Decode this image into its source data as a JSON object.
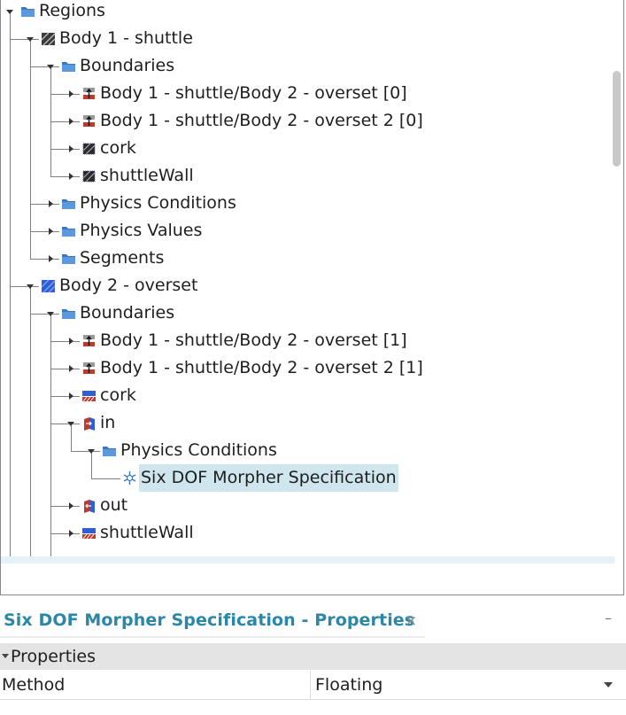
{
  "tree": {
    "nodes": [
      {
        "label": "Regions",
        "icon": "folder-icon",
        "depth": 0,
        "toggle": "expanded"
      },
      {
        "label": "Body 1 - shuttle",
        "icon": "region-hatched-icon",
        "depth": 1,
        "toggle": "expanded"
      },
      {
        "label": "Boundaries",
        "icon": "folder-icon",
        "depth": 2,
        "toggle": "expanded"
      },
      {
        "label": "Body 1 - shuttle/Body 2 - overset [0]",
        "icon": "interface-boundary-icon",
        "depth": 3,
        "toggle": "collapsed"
      },
      {
        "label": "Body 1 - shuttle/Body 2 - overset 2 [0]",
        "icon": "interface-boundary-icon",
        "depth": 3,
        "toggle": "collapsed"
      },
      {
        "label": "cork",
        "icon": "wall-boundary-icon",
        "depth": 3,
        "toggle": "collapsed"
      },
      {
        "label": "shuttleWall",
        "icon": "wall-boundary-icon",
        "depth": 3,
        "toggle": "collapsed"
      },
      {
        "label": "Physics Conditions",
        "icon": "folder-icon",
        "depth": 2,
        "toggle": "collapsed"
      },
      {
        "label": "Physics Values",
        "icon": "folder-icon",
        "depth": 2,
        "toggle": "collapsed"
      },
      {
        "label": "Segments",
        "icon": "folder-icon",
        "depth": 2,
        "toggle": "collapsed"
      },
      {
        "label": "Body 2 - overset",
        "icon": "region-blue-icon",
        "depth": 1,
        "toggle": "expanded"
      },
      {
        "label": "Boundaries",
        "icon": "folder-icon",
        "depth": 2,
        "toggle": "expanded"
      },
      {
        "label": "Body 1 - shuttle/Body 2 - overset [1]",
        "icon": "interface-boundary-icon",
        "depth": 3,
        "toggle": "collapsed"
      },
      {
        "label": "Body 1 - shuttle/Body 2 - overset 2 [1]",
        "icon": "interface-boundary-icon",
        "depth": 3,
        "toggle": "collapsed"
      },
      {
        "label": "cork",
        "icon": "blue-wall-boundary-icon",
        "depth": 3,
        "toggle": "collapsed"
      },
      {
        "label": "in",
        "icon": "inlet-boundary-icon",
        "depth": 3,
        "toggle": "expanded"
      },
      {
        "label": "Physics Conditions",
        "icon": "folder-icon",
        "depth": 4,
        "toggle": "expanded"
      },
      {
        "label": "Six DOF Morpher Specification",
        "icon": "six-dof-icon",
        "depth": 5,
        "toggle": "none",
        "selected": true
      },
      {
        "label": "out",
        "icon": "outlet-boundary-icon",
        "depth": 3,
        "toggle": "collapsed"
      },
      {
        "label": "shuttleWall",
        "icon": "blue-wall-boundary-icon",
        "depth": 3,
        "toggle": "collapsed"
      }
    ]
  },
  "properties_panel": {
    "title": "Six DOF Morpher Specification - Properties",
    "close_glyph": "×",
    "minimize_glyph": "–",
    "section_label": "Properties",
    "rows": [
      {
        "name": "Method",
        "value": "Floating"
      }
    ]
  },
  "colors": {
    "selection": "#cfe6ee",
    "tab_title": "#2a87a8",
    "folder": "#3b78c2",
    "region_blue": "#2f5fd6"
  }
}
